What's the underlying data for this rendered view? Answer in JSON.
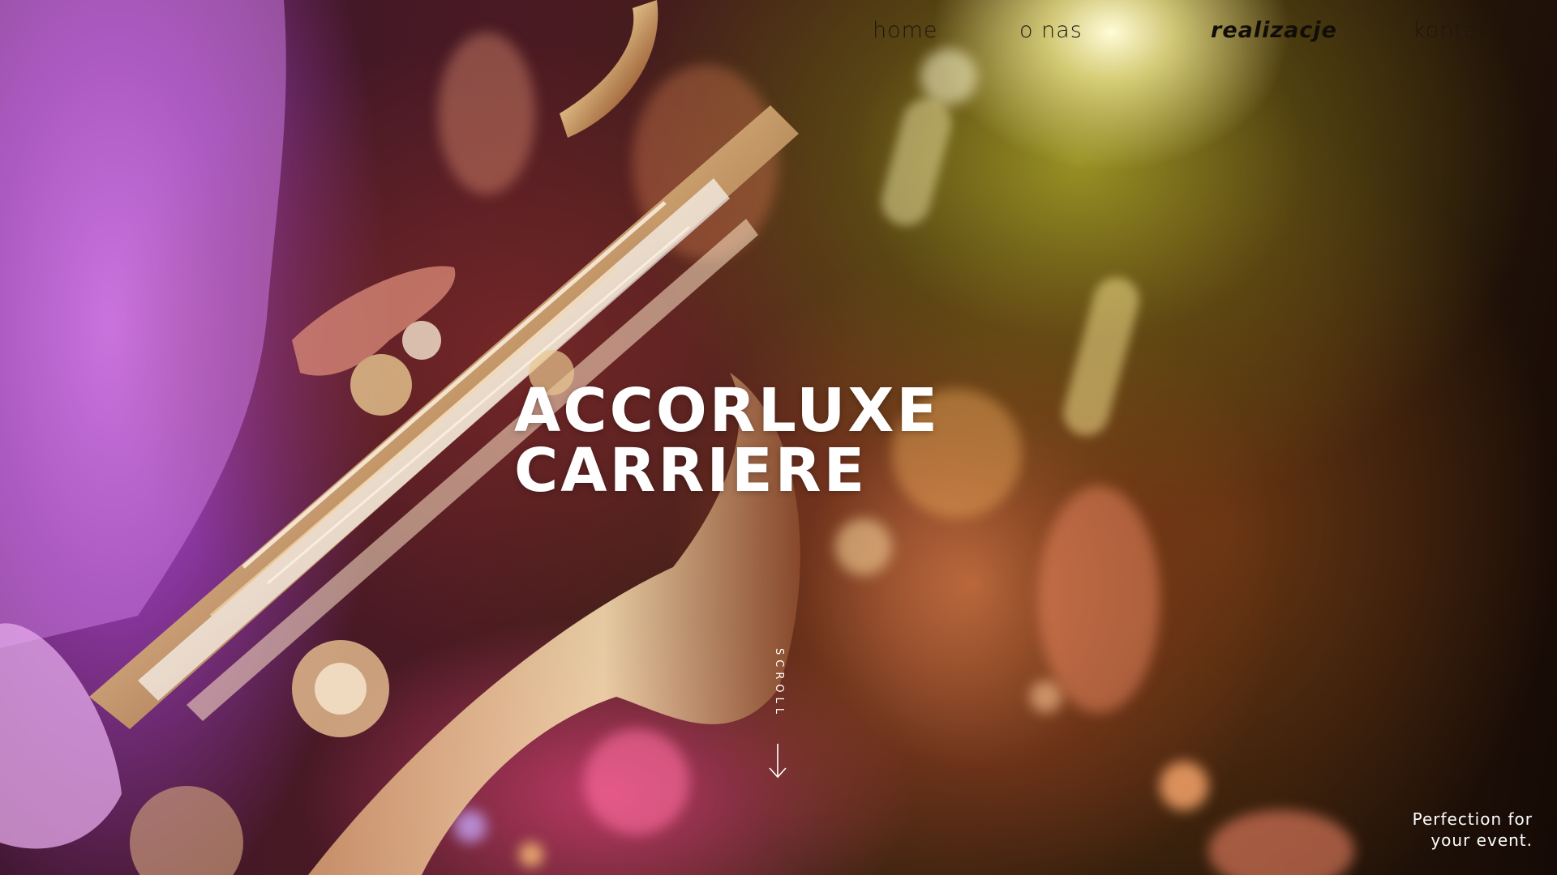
{
  "nav": {
    "items": [
      {
        "label": "home",
        "active": false
      },
      {
        "label": "o nas",
        "active": false
      },
      {
        "label": "realizacje",
        "active": true
      },
      {
        "label": "kontakt",
        "active": false
      }
    ]
  },
  "hero": {
    "title_line1": "ACCORLUXE",
    "title_line2": "CARRIERE",
    "scroll_label": "SCROLL",
    "tagline_line1": "Perfection for",
    "tagline_line2": "your event."
  },
  "colors": {
    "nav_text": "#1e1710",
    "hero_text": "#ffffff",
    "stage_light": "#f6ee96",
    "saxophone": "#e8c890"
  },
  "icons": {
    "scroll": "arrow-down-icon"
  }
}
